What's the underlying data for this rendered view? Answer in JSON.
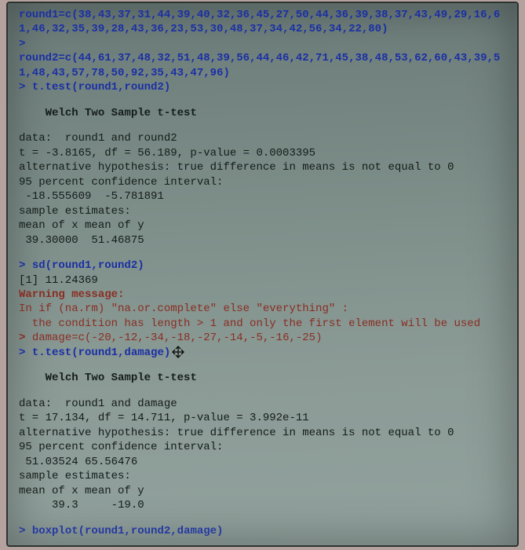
{
  "commands": {
    "round1_assign": "round1=c(38,43,37,31,44,39,40,32,36,45,27,50,44,36,39,38,37,43,49,29,16,61,46,32,35,39,28,43,36,23,53,30,48,37,34,42,56,34,22,80)",
    "round2_assign": "round2=c(44,61,37,48,32,51,48,39,56,44,46,42,71,45,38,48,53,62,60,43,39,51,48,43,57,78,50,92,35,43,47,96)",
    "ttest1": "t.test(round1,round2)",
    "sd_call": "sd(round1,round2)",
    "damage_assign": "damage=c(-20,-12,-34,-18,-27,-14,-5,-16,-25)",
    "ttest2": "t.test(round1,damage)",
    "boxplot": "boxplot(round1,round2,damage)"
  },
  "prompt_text": "> ",
  "blank_prompt": ">",
  "test1": {
    "title": "Welch Two Sample t-test",
    "data_line": "data:  round1 and round2",
    "stat_line": "t = -3.8165, df = 56.189, p-value = 0.0003395",
    "alt_line": "alternative hypothesis: true difference in means is not equal to 0",
    "ci_header": "95 percent confidence interval:",
    "ci_values": " -18.555609  -5.781891",
    "est_header": "sample estimates:",
    "est_labels": "mean of x mean of y",
    "est_values": " 39.30000  51.46875"
  },
  "sd_output": "[1] 11.24369",
  "warning": {
    "header": "Warning message:",
    "line1": "In if (na.rm) \"na.or.complete\" else \"everything\" :",
    "line2": "  the condition has length > 1 and only the first element will be used"
  },
  "test2": {
    "title": "Welch Two Sample t-test",
    "data_line": "data:  round1 and damage",
    "stat_line": "t = 17.134, df = 14.711, p-value = 3.992e-11",
    "alt_line": "alternative hypothesis: true difference in means is not equal to 0",
    "ci_header": "95 percent confidence interval:",
    "ci_values": " 51.03524 65.56476",
    "est_header": "sample estimates:",
    "est_labels": "mean of x mean of y",
    "est_values": "     39.3     -19.0"
  }
}
